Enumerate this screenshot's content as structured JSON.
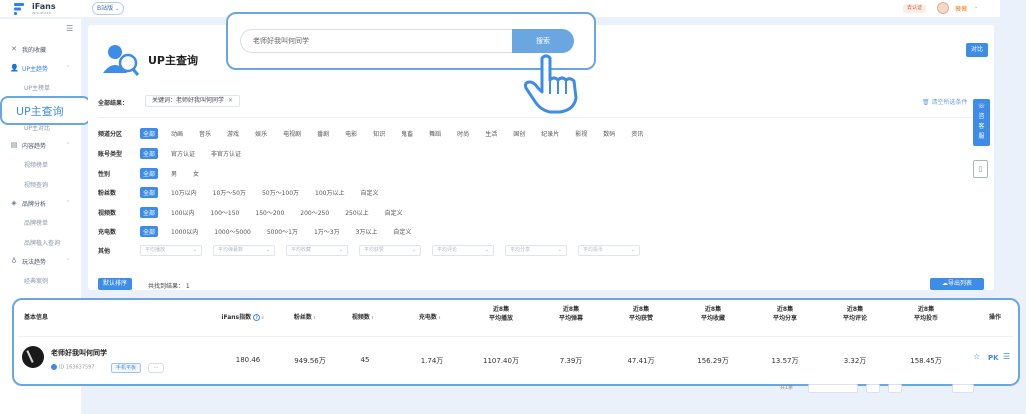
{
  "topbar": {
    "logo_text": "iFans",
    "logo_sub": "INFLUENCER",
    "version_label": "B站版",
    "cert_label": "去认证",
    "user_name": "薇薇"
  },
  "sidebar": {
    "items": [
      {
        "label": "我的收藏",
        "icon": "close-icon"
      },
      {
        "label": "UP主趋势",
        "icon": "user-icon"
      },
      {
        "label": "内容趋势",
        "icon": "document-icon"
      },
      {
        "label": "品牌分析",
        "icon": "diamond-icon"
      },
      {
        "label": "玩法趋势",
        "icon": "bulb-icon"
      }
    ],
    "sub_up": [
      "UP主榜单",
      "UP主查询",
      "UP主对比"
    ],
    "sub_content": [
      "视频榜单",
      "视频查询"
    ],
    "sub_brand": [
      "品牌榜单",
      "品牌植入查询"
    ],
    "sub_play": [
      "经典案例"
    ],
    "highlight_label": "UP主查询"
  },
  "page": {
    "title": "UP主查询",
    "contrast_label": "对比",
    "selected_label": "全部结果：",
    "chip_label": "关键词：老师好我叫何同学",
    "clear_label": "清空所选条件",
    "float_labels": [
      "咨",
      "客",
      "服"
    ]
  },
  "search": {
    "placeholder": "老师好我叫何同学",
    "button": "搜索"
  },
  "filters": {
    "category": {
      "label": "频道分区",
      "options": [
        "全部",
        "动画",
        "音乐",
        "游戏",
        "娱乐",
        "电视剧",
        "番剧",
        "电影",
        "知识",
        "鬼畜",
        "舞蹈",
        "时尚",
        "生活",
        "国创",
        "纪录片",
        "影视",
        "数码",
        "资讯"
      ]
    },
    "account": {
      "label": "账号类型",
      "options": [
        "全部",
        "官方认证",
        "非官方认证"
      ]
    },
    "gender": {
      "label": "性别",
      "options": [
        "全部",
        "男",
        "女"
      ]
    },
    "fans": {
      "label": "粉丝数",
      "options": [
        "全部",
        "10万以内",
        "10万～50万",
        "50万～100万",
        "100万以上",
        "自定义"
      ]
    },
    "videos": {
      "label": "视频数",
      "options": [
        "全部",
        "100以内",
        "100～150",
        "150～200",
        "200～250",
        "250以上",
        "自定义"
      ]
    },
    "charge": {
      "label": "充电数",
      "options": [
        "全部",
        "1000以内",
        "1000～5000",
        "5000～1万",
        "1万～3万",
        "3万以上",
        "自定义"
      ]
    },
    "other": {
      "label": "其他",
      "dropdowns": [
        "平均播放",
        "平均弹幕数",
        "平均收藏",
        "平均获赞",
        "平均评论",
        "平均分享",
        "平均投币"
      ]
    }
  },
  "result_bar": {
    "sort_label": "默认排序",
    "count_text": "共找到结果：  1",
    "export_label": "导出列表"
  },
  "table": {
    "headers": [
      "基本信息",
      "iFans指数",
      "粉丝数",
      "视频数",
      "充电数",
      "近8集\n平均播放",
      "近8集\n平均弹幕",
      "近8集\n平均获赞",
      "近8集\n平均收藏",
      "近8集\n平均分享",
      "近8集\n平均评论",
      "近8集\n平均投币",
      "操作"
    ],
    "row": {
      "name": "老师好我叫何同学",
      "id": "ID 163637597",
      "tag": "手机平板",
      "tag_more": "···",
      "values": [
        "180.46",
        "949.56万",
        "45",
        "1.74万",
        "1107.40万",
        "7.39万",
        "47.41万",
        "156.29万",
        "13.57万",
        "3.32万",
        "158.45万"
      ],
      "actions": [
        "star-icon",
        "PK",
        "list-icon"
      ]
    }
  },
  "pager": {
    "text": "共1条"
  }
}
